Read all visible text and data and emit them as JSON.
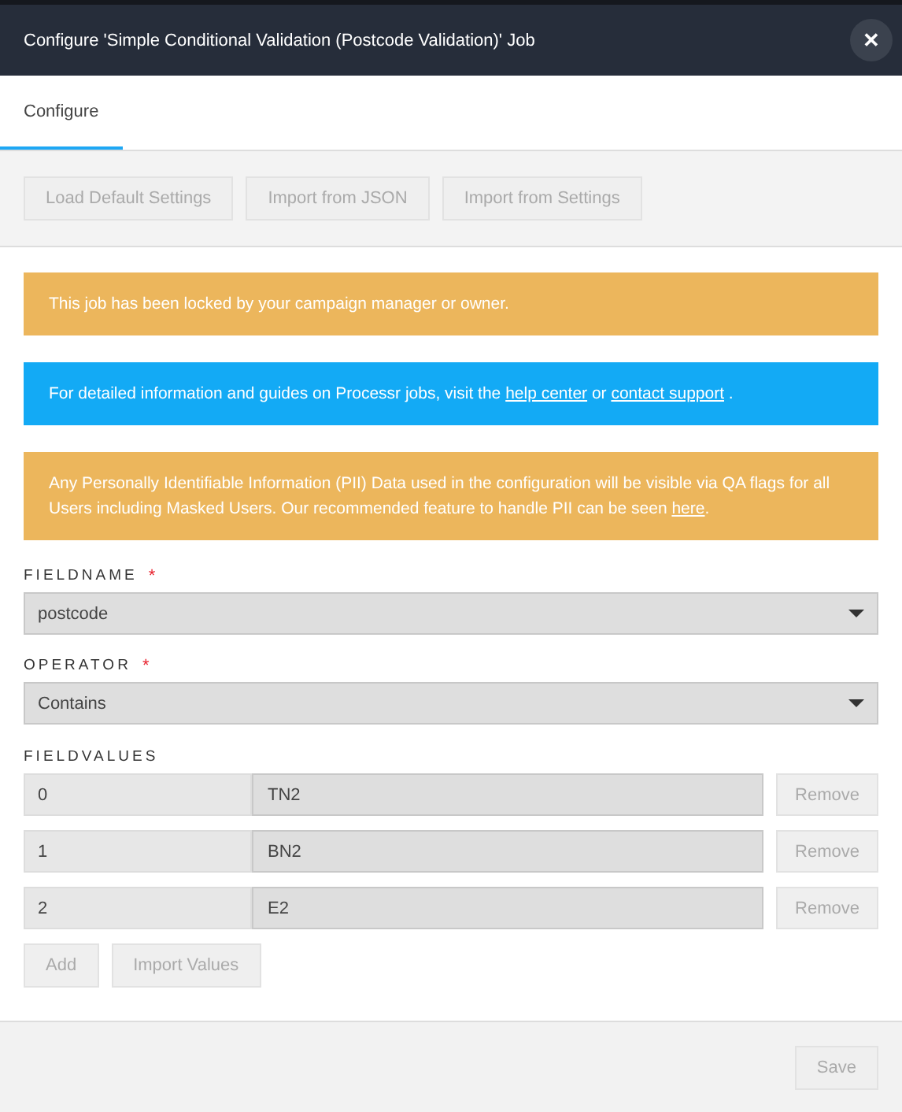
{
  "window": {
    "title": "Configure 'Simple Conditional Validation (Postcode Validation)' Job",
    "close_label": "✕"
  },
  "tabs": [
    {
      "label": "Configure",
      "selected": true
    }
  ],
  "toolbar": [
    {
      "label": "Load Default Settings",
      "disabled": true
    },
    {
      "label": "Import from JSON",
      "disabled": true
    },
    {
      "label": "Import from Settings",
      "disabled": true
    }
  ],
  "alerts": [
    {
      "kind": "warning",
      "segments": [
        {
          "text": "This job has been locked by your campaign manager or owner.",
          "link": false
        }
      ]
    },
    {
      "kind": "info",
      "segments": [
        {
          "text": "For detailed information and guides on Processr jobs, visit the ",
          "link": false
        },
        {
          "text": "help center",
          "link": true
        },
        {
          "text": " or ",
          "link": false
        },
        {
          "text": "contact support",
          "link": true
        },
        {
          "text": " .",
          "link": false
        }
      ]
    },
    {
      "kind": "warning",
      "segments": [
        {
          "text": "Any Personally Identifiable Information (PII) Data used in the configuration will be visible via QA flags for all Users including Masked Users. Our recommended feature to handle PII can be seen ",
          "link": false
        },
        {
          "text": "here",
          "link": true
        },
        {
          "text": ".",
          "link": false
        }
      ]
    }
  ],
  "fields": [
    {
      "label": "FIELDNAME",
      "required_mark": "*",
      "value": "postcode"
    },
    {
      "label": "OPERATOR",
      "required_mark": "*",
      "value": "Contains"
    }
  ],
  "fieldvalues": {
    "label": "FIELDVALUES",
    "rows": [
      {
        "index": "0",
        "value": "TN2",
        "remove": "Remove"
      },
      {
        "index": "1",
        "value": "BN2",
        "remove": "Remove"
      },
      {
        "index": "2",
        "value": "E2",
        "remove": "Remove"
      }
    ],
    "buttons": [
      {
        "label": "Add",
        "disabled": true
      },
      {
        "label": "Import Values",
        "disabled": true
      }
    ]
  },
  "footer": {
    "save": {
      "label": "Save",
      "disabled": true
    }
  }
}
